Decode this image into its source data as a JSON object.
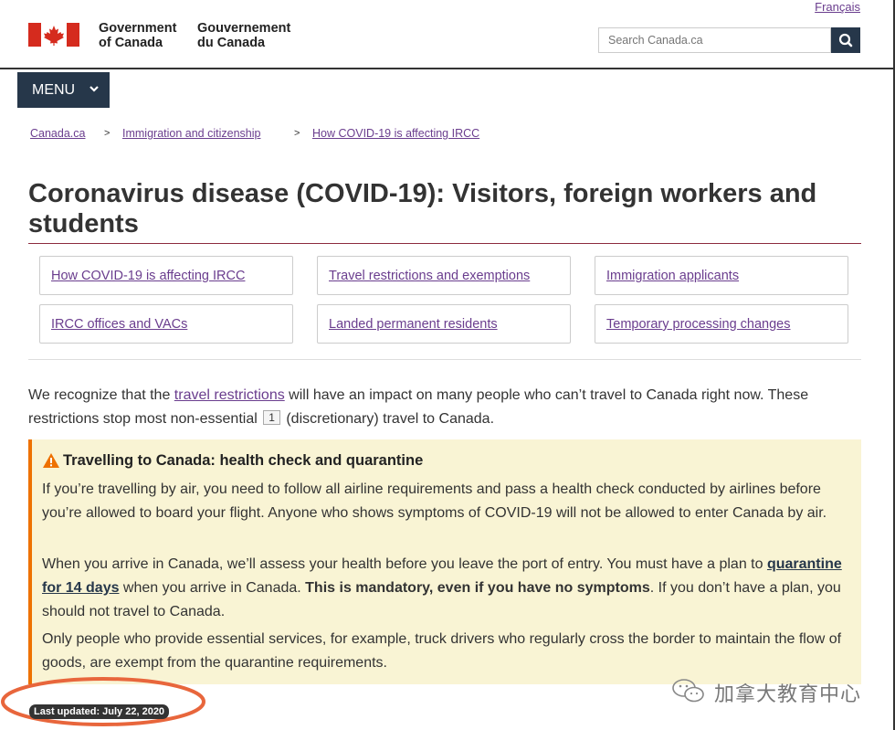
{
  "header": {
    "language_link": "Français",
    "gov_en_line1": "Government",
    "gov_en_line2": "of Canada",
    "gov_fr_line1": "Gouvernement",
    "gov_fr_line2": "du Canada",
    "search_placeholder": "Search Canada.ca",
    "menu_label": "MENU"
  },
  "breadcrumb": [
    "Canada.ca",
    "Immigration and citizenship",
    "How COVID-19 is affecting IRCC"
  ],
  "breadcrumb_separator": ">",
  "title_line1": "Coronavirus disease (COVID-19): Visitors, foreign workers and",
  "title_line2": "students",
  "links": [
    "How COVID-19 is affecting IRCC",
    "Travel restrictions and exemptions",
    "Immigration applicants",
    "IRCC offices and VACs",
    "Landed permanent residents",
    "Temporary processing changes"
  ],
  "intro": {
    "before_link": "We recognize that the ",
    "link": "travel restrictions",
    "after_link": " will have an impact on many people who can’t travel to Canada right now. These restrictions stop most non-essential ",
    "footnote": "1",
    "end": " (discretionary) travel to Canada."
  },
  "alert": {
    "title": "Travelling to Canada: health check and quarantine",
    "p1": "If you’re travelling by air, you need to follow all airline requirements and pass a health check conducted by airlines before you’re allowed to board your flight. Anyone who shows symptoms of COVID-19 will not be allowed to enter Canada by air.",
    "p2_before": "When you arrive in Canada, we’ll assess your health before you leave the port of entry. You must have a plan to ",
    "p2_link": "quarantine for 14 days",
    "p2_middle": " when you arrive in Canada. ",
    "p2_bold": "This is mandatory, even if you have no symptoms",
    "p2_after": ". If you don’t have a plan, you should not travel to Canada.",
    "p3": "Only people who provide essential services, for example, truck drivers who regularly cross the border to maintain the flow of goods, are exempt from the quarantine requirements."
  },
  "last_updated": "Last updated: July 22, 2020",
  "watermark": "加拿大教育中心",
  "colors": {
    "navy": "#26374a",
    "link": "#6a3d8e",
    "alert_bg": "#f9f4d4",
    "alert_border": "#ee7100",
    "annotation": "#e8663c",
    "flag_red": "#d52b1e"
  },
  "icons": [
    "maple-leaf-flag",
    "search-icon",
    "chevron-down-icon",
    "warning-icon",
    "wechat-icon"
  ]
}
